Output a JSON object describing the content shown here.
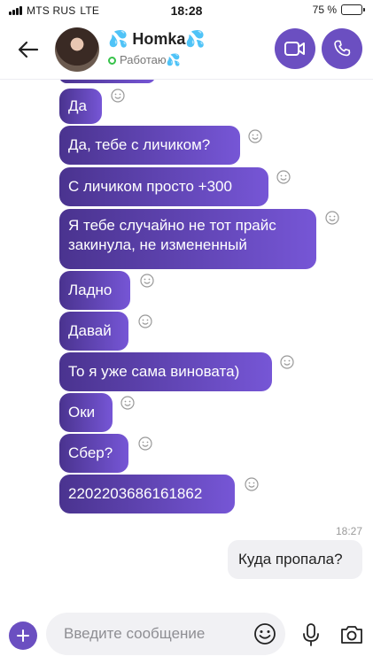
{
  "status_bar": {
    "carrier": "MTS RUS",
    "network": "LTE",
    "time": "18:28",
    "battery_text": "75 %",
    "battery_level": 0.75
  },
  "header": {
    "back_icon": "arrow-left-icon",
    "contact_name": "💦 Homka💦",
    "contact_status": "Работаю💦",
    "video_icon": "video-camera-icon",
    "call_icon": "phone-icon",
    "accent_color": "#6b4fc1"
  },
  "messages": {
    "incoming": [
      "Да",
      "Да, тебе с личиком?",
      "С личиком просто +300",
      "Я тебе случайно не тот прайс закинула, не измененный",
      "Ладно",
      "Давай",
      "То я уже сама виновата)",
      "Оки",
      "Сбер?",
      "2202203686161862"
    ],
    "time_label": "18:27",
    "outgoing": "Куда пропала?"
  },
  "composer": {
    "placeholder": "Введите сообщение",
    "value": "",
    "plus_icon": "plus-icon",
    "emoji_icon": "smiley-icon",
    "mic_icon": "microphone-icon",
    "camera_icon": "camera-icon"
  }
}
